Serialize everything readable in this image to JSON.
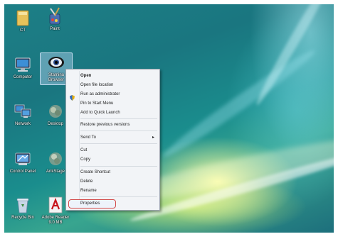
{
  "desktop": {
    "icons": [
      {
        "label": "CT",
        "icon": "folder-icon"
      },
      {
        "label": "Paint",
        "icon": "paint-icon"
      },
      {
        "label": "Computer",
        "icon": "computer-icon"
      },
      {
        "label": "Stamina Browser",
        "icon": "eye-app-icon"
      },
      {
        "label": "Network",
        "icon": "network-icon"
      },
      {
        "label": "Desktop",
        "icon": "blurred-app-icon"
      },
      {
        "label": "Control Panel",
        "icon": "control-panel-icon"
      },
      {
        "label": "AnkStage",
        "icon": "blurred-app-icon"
      },
      {
        "label": "Recycle Bin",
        "icon": "recycle-bin-icon"
      },
      {
        "label": "Adobe Reader 9.0 MB",
        "icon": "adobe-reader-icon"
      }
    ]
  },
  "context_menu": {
    "items": [
      "Open",
      "Open file location",
      "Run as administrator",
      "Pin to Start Menu",
      "Add to Quick Launch",
      "Restore previous versions",
      "Send To",
      "Cut",
      "Copy",
      "Create Shortcut",
      "Delete",
      "Rename",
      "Properties"
    ],
    "highlight_color": "#d24a4a"
  }
}
